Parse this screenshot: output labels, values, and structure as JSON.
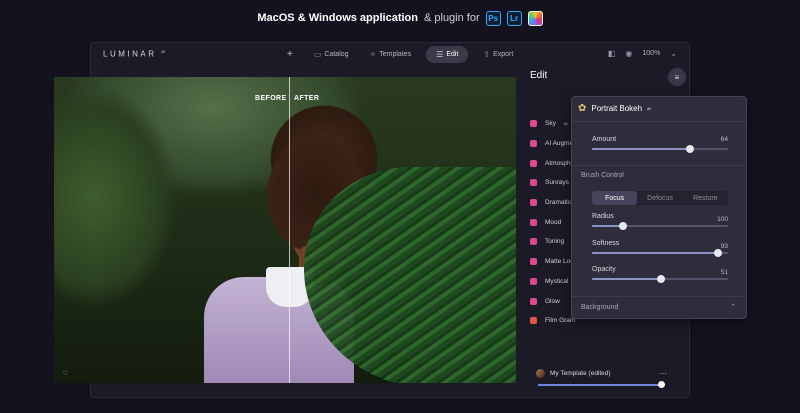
{
  "banner": {
    "bold_text": "MacOS & Windows application",
    "rest_text": "& plugin for",
    "plugins": [
      {
        "label": "Ps",
        "icon": "photoshop-icon"
      },
      {
        "label": "Lr",
        "icon": "lightroom-icon"
      },
      {
        "label": "",
        "icon": "apple-photos-icon"
      }
    ]
  },
  "window": {
    "logo": "LUMINAR",
    "logo_version": "AI",
    "toolbar": {
      "add_icon": "+",
      "catalog_label": "Catalog",
      "templates_label": "Templates",
      "edit_label": "Edit",
      "export_label": "Export",
      "zoom": "100%"
    }
  },
  "photo": {
    "before_label": "BEFORE",
    "after_label": "AFTER",
    "split_position": 0.51
  },
  "edit_panel": {
    "title": "Edit",
    "tools": [
      {
        "label": "Sky",
        "sup": "AI",
        "color": "#d94a8f"
      },
      {
        "label": "AI Augmented",
        "color": "#d94a8f"
      },
      {
        "label": "Atmosphere",
        "color": "#d94a8f"
      },
      {
        "label": "Sunrays",
        "color": "#d94a8f"
      },
      {
        "label": "Dramatic",
        "color": "#d94a8f"
      },
      {
        "label": "Mood",
        "color": "#d94a8f"
      },
      {
        "label": "Toning",
        "color": "#d94a8f"
      },
      {
        "label": "Matte Look",
        "color": "#d94a8f"
      },
      {
        "label": "Mystical",
        "color": "#d94a8f"
      },
      {
        "label": "Glow",
        "color": "#d94a8f"
      },
      {
        "label": "Film Grain",
        "color": "#e0564a"
      }
    ]
  },
  "popup": {
    "title": "Portrait Bokeh",
    "title_sup": "AI",
    "amount": {
      "label": "Amount",
      "value": "64",
      "fraction": 0.72
    },
    "brush_control_label": "Brush Control",
    "segments": [
      "Focus",
      "Defocus",
      "Restore"
    ],
    "active_segment": 0,
    "radius": {
      "label": "Radius",
      "value": "100",
      "fraction": 0.23
    },
    "softness": {
      "label": "Softness",
      "value": "93",
      "fraction": 0.93
    },
    "opacity": {
      "label": "Opacity",
      "value": "51",
      "fraction": 0.51
    },
    "background_label": "Background"
  },
  "template": {
    "label": "My Template (edited)",
    "more": "···",
    "fraction": 0.98
  }
}
